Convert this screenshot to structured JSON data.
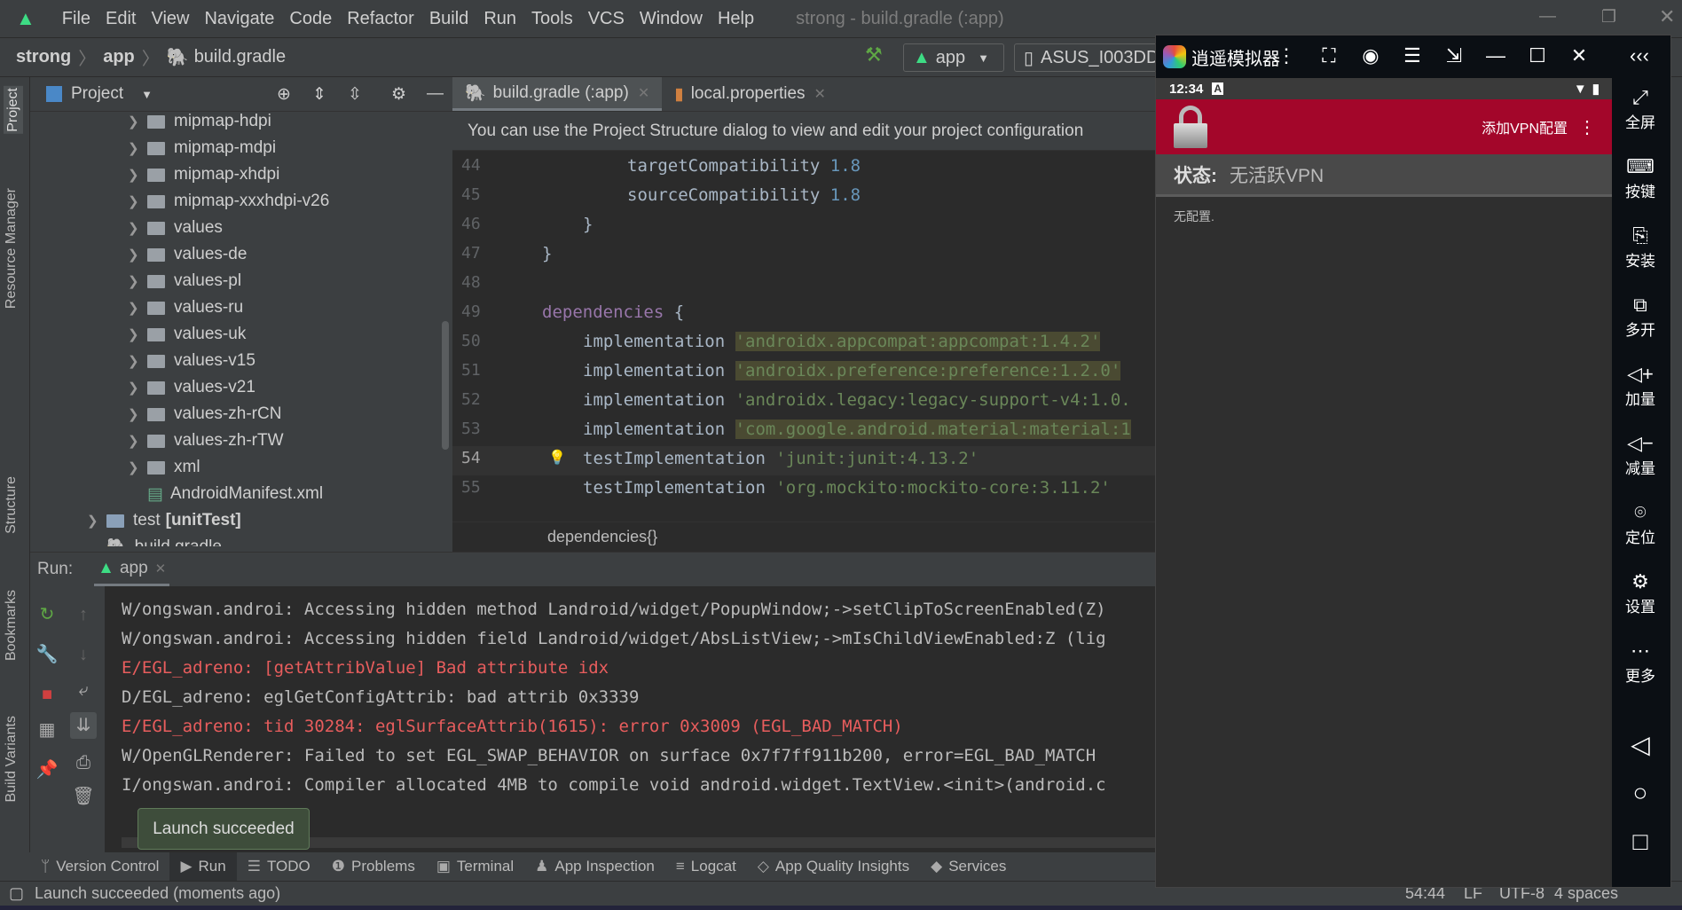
{
  "menubar": {
    "items": [
      "File",
      "Edit",
      "View",
      "Navigate",
      "Code",
      "Refactor",
      "Build",
      "Run",
      "Tools",
      "VCS",
      "Window",
      "Help"
    ],
    "title": "strong - build.gradle (:app)"
  },
  "navbar": {
    "breadcrumb": [
      "strong",
      "app",
      "build.gradle"
    ],
    "run_config": "app",
    "device": "ASUS_I003DD"
  },
  "left_strip": {
    "items": [
      "Project",
      "Resource Manager",
      "Structure",
      "Bookmarks",
      "Build Variants"
    ]
  },
  "project": {
    "title": "Project",
    "tree": [
      {
        "label": "mipmap-hdpi",
        "type": "folder"
      },
      {
        "label": "mipmap-mdpi",
        "type": "folder"
      },
      {
        "label": "mipmap-xhdpi",
        "type": "folder"
      },
      {
        "label": "mipmap-xxxhdpi-v26",
        "type": "folder"
      },
      {
        "label": "values",
        "type": "folder"
      },
      {
        "label": "values-de",
        "type": "folder"
      },
      {
        "label": "values-pl",
        "type": "folder"
      },
      {
        "label": "values-ru",
        "type": "folder"
      },
      {
        "label": "values-uk",
        "type": "folder"
      },
      {
        "label": "values-v15",
        "type": "folder"
      },
      {
        "label": "values-v21",
        "type": "folder"
      },
      {
        "label": "values-zh-rCN",
        "type": "folder"
      },
      {
        "label": "values-zh-rTW",
        "type": "folder"
      },
      {
        "label": "xml",
        "type": "folder"
      },
      {
        "label": "AndroidManifest.xml",
        "type": "file"
      },
      {
        "label": "test",
        "suffix": "[unitTest]",
        "type": "folder"
      },
      {
        "label": "build.gradle",
        "type": "gradle"
      }
    ]
  },
  "editor": {
    "tabs": [
      {
        "label": "build.gradle (:app)",
        "active": true
      },
      {
        "label": "local.properties",
        "active": false
      }
    ],
    "banner": "You can use the Project Structure dialog to view and edit your project configuration",
    "lines": [
      {
        "n": "44",
        "code": "targetCompatibility",
        "arg": "1.8"
      },
      {
        "n": "45",
        "code": "sourceCompatibility",
        "arg": "1.8"
      },
      {
        "n": "46",
        "code": "}"
      },
      {
        "n": "47",
        "code": "}"
      },
      {
        "n": "48",
        "code": ""
      },
      {
        "n": "49",
        "code": "dependencies",
        "arg": "{"
      },
      {
        "n": "50",
        "code": "implementation",
        "arg": "'androidx.appcompat:appcompat:1.4.2'"
      },
      {
        "n": "51",
        "code": "implementation",
        "arg": "'androidx.preference:preference:1.2.0'"
      },
      {
        "n": "52",
        "code": "implementation",
        "arg": "'androidx.legacy:legacy-support-v4:1.0."
      },
      {
        "n": "53",
        "code": "implementation",
        "arg": "'com.google.android.material:material:1"
      },
      {
        "n": "54",
        "code": "testImplementation",
        "arg": "'junit:junit:4.13.2'"
      },
      {
        "n": "55",
        "code": "testImplementation",
        "arg": "'org.mockito:mockito-core:3.11.2'"
      }
    ],
    "breadcrumb": "dependencies{}"
  },
  "run": {
    "label": "Run:",
    "tab": "app",
    "lines": [
      {
        "level": "W",
        "text": "W/ongswan.androi: Accessing hidden method Landroid/widget/PopupWindow;->setClipToScreenEnabled(Z)"
      },
      {
        "level": "W",
        "text": "W/ongswan.androi: Accessing hidden field Landroid/widget/AbsListView;->mIsChildViewEnabled:Z (lig"
      },
      {
        "level": "E",
        "text": "E/EGL_adreno: [getAttribValue] Bad attribute idx"
      },
      {
        "level": "D",
        "text": "D/EGL_adreno: eglGetConfigAttrib: bad attrib 0x3339"
      },
      {
        "level": "E",
        "text": "E/EGL_adreno: tid 30284: eglSurfaceAttrib(1615): error 0x3009 (EGL_BAD_MATCH)"
      },
      {
        "level": "W",
        "text": "W/OpenGLRenderer: Failed to set EGL_SWAP_BEHAVIOR on surface 0x7f7ff911b200, error=EGL_BAD_MATCH"
      },
      {
        "level": "I",
        "text": "I/ongswan.androi: Compiler allocated 4MB to compile void android.widget.TextView.<init>(android.c"
      }
    ],
    "tooltip": "Launch succeeded"
  },
  "toolwindows": [
    "Version Control",
    "Run",
    "TODO",
    "Problems",
    "Terminal",
    "App Inspection",
    "Logcat",
    "App Quality Insights",
    "Services"
  ],
  "status": {
    "message": "Launch succeeded (moments ago)",
    "position": "54:44",
    "line_sep": "LF",
    "encoding": "UTF-8",
    "indent": "4 spaces"
  },
  "emulator": {
    "title": "逍遥模拟器",
    "time": "12:34",
    "menu": "添加VPN配置",
    "status_label": "状态:",
    "status_value": "无活跃VPN",
    "empty": "无配置.",
    "side": [
      {
        "icon": "fullscreen",
        "label": "全屏"
      },
      {
        "icon": "keyboard",
        "label": "按键"
      },
      {
        "icon": "apk",
        "label": "安装"
      },
      {
        "icon": "multi",
        "label": "多开"
      },
      {
        "icon": "volume-up",
        "label": "加量"
      },
      {
        "icon": "volume-down",
        "label": "减量"
      },
      {
        "icon": "location",
        "label": "定位"
      },
      {
        "icon": "settings",
        "label": "设置"
      },
      {
        "icon": "more",
        "label": "更多"
      }
    ],
    "colors": {
      "appbar": "#a3062a"
    }
  }
}
